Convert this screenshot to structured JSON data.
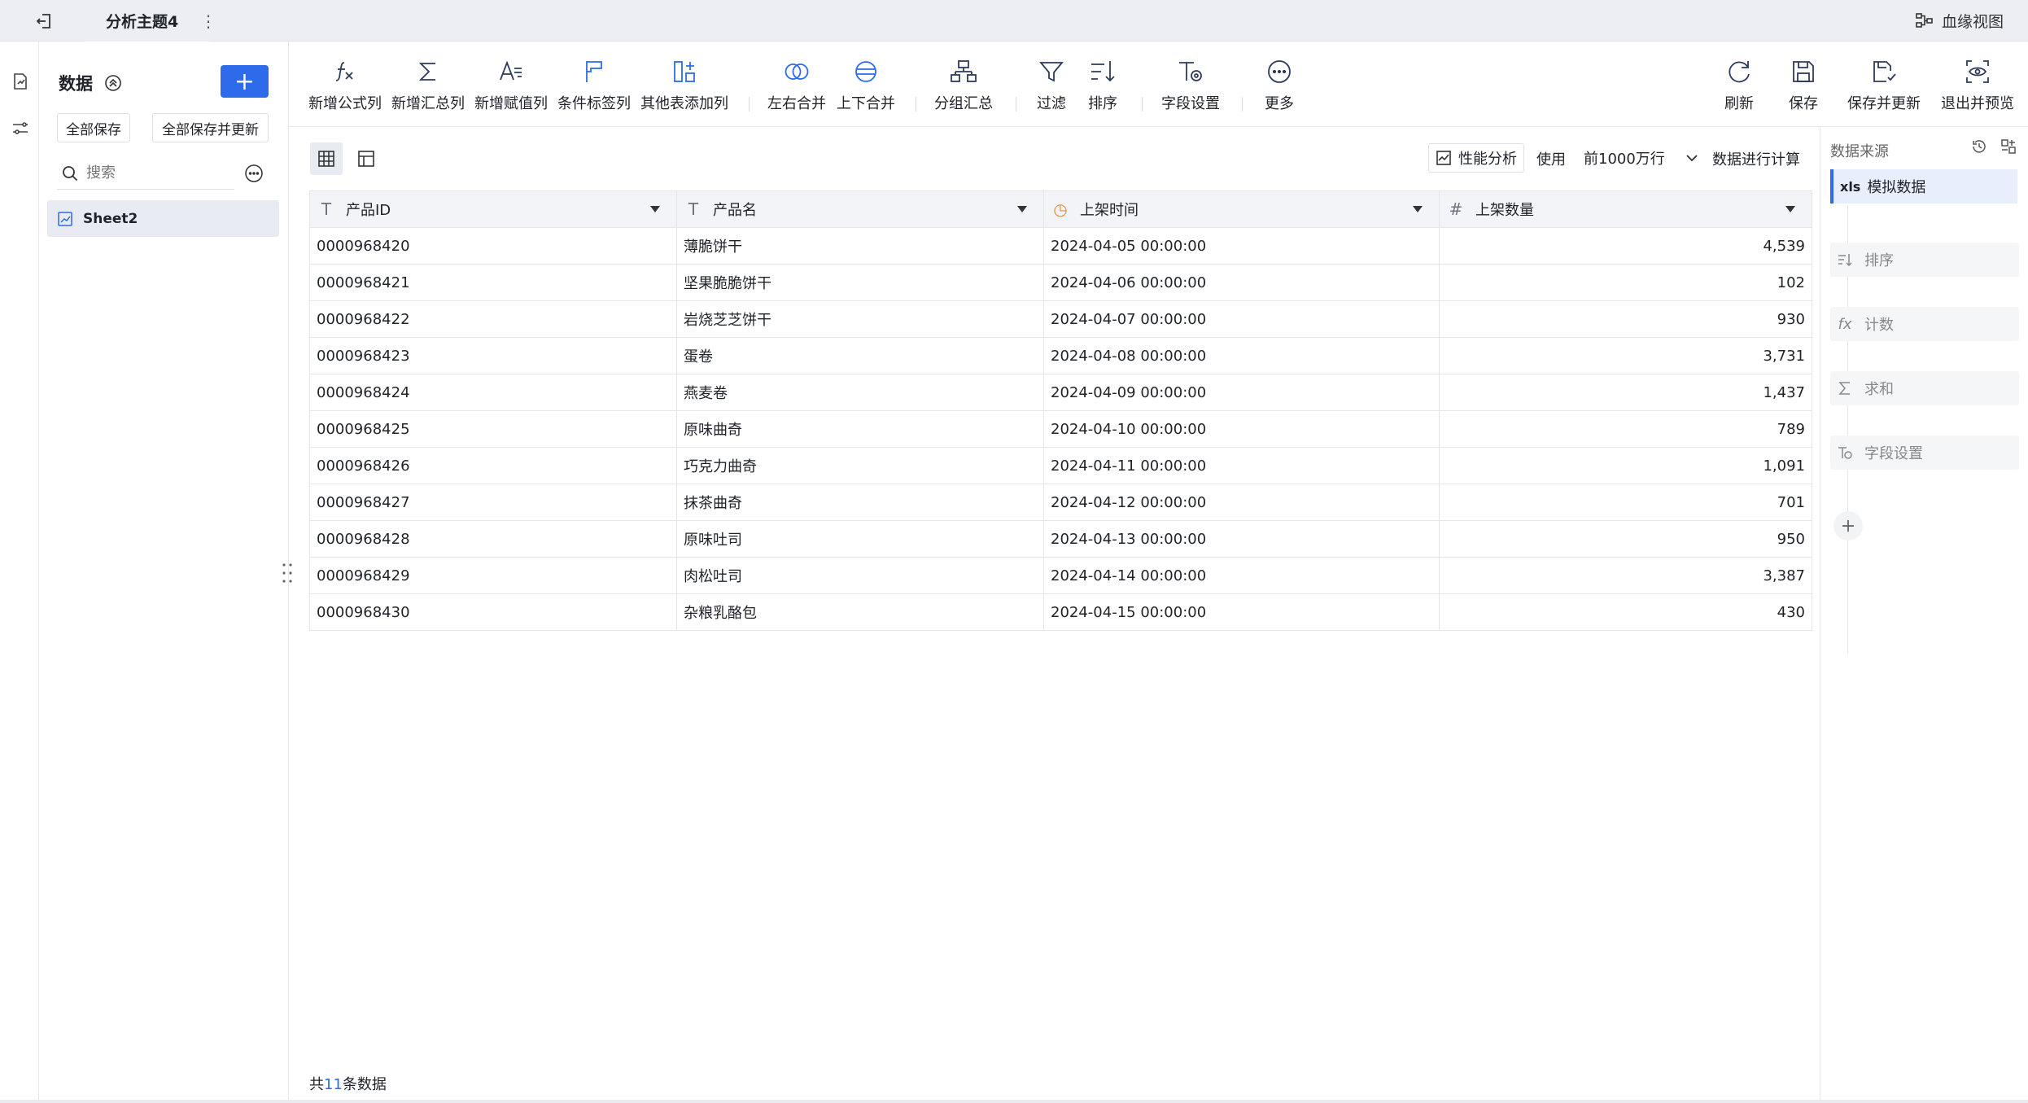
{
  "topbar": {
    "tab_title": "分析主题4",
    "tab_menu": "⋮",
    "lineage_label": "血缘视图"
  },
  "panel": {
    "title": "数据",
    "add_label": "+",
    "save_all": "全部保存",
    "save_all_update": "全部保存并更新",
    "search_placeholder": "搜索",
    "sheet_name": "Sheet2"
  },
  "toolbar": {
    "formula": "新增公式列",
    "summary": "新增汇总列",
    "assign": "新增赋值列",
    "condition": "条件标签列",
    "other_table": "其他表添加列",
    "lr_merge": "左右合并",
    "ud_merge": "上下合并",
    "group": "分组汇总",
    "filter": "过滤",
    "sort": "排序",
    "field_settings": "字段设置",
    "more": "更多",
    "refresh": "刷新",
    "save": "保存",
    "save_update": "保存并更新",
    "exit_preview": "退出并预览"
  },
  "main": {
    "perf_label": "性能分析",
    "use_label": "使用",
    "rows_value": "前1000万行",
    "calc_label": "数据进行计算"
  },
  "table": {
    "columns": [
      {
        "name": "产品ID",
        "type_icon": "T"
      },
      {
        "name": "产品名",
        "type_icon": "T"
      },
      {
        "name": "上架时间",
        "type_icon": "◷"
      },
      {
        "name": "上架数量",
        "type_icon": "#"
      }
    ],
    "rows": [
      [
        "0000968420",
        "薄脆饼干",
        "2024-04-05 00:00:00",
        "4,539"
      ],
      [
        "0000968421",
        "坚果脆脆饼干",
        "2024-04-06 00:00:00",
        "102"
      ],
      [
        "0000968422",
        "岩烧芝芝饼干",
        "2024-04-07 00:00:00",
        "930"
      ],
      [
        "0000968423",
        "蛋卷",
        "2024-04-08 00:00:00",
        "3,731"
      ],
      [
        "0000968424",
        "燕麦卷",
        "2024-04-09 00:00:00",
        "1,437"
      ],
      [
        "0000968425",
        "原味曲奇",
        "2024-04-10 00:00:00",
        "789"
      ],
      [
        "0000968426",
        "巧克力曲奇",
        "2024-04-11 00:00:00",
        "1,091"
      ],
      [
        "0000968427",
        "抹茶曲奇",
        "2024-04-12 00:00:00",
        "701"
      ],
      [
        "0000968428",
        "原味吐司",
        "2024-04-13 00:00:00",
        "950"
      ],
      [
        "0000968429",
        "肉松吐司",
        "2024-04-14 00:00:00",
        "3,387"
      ],
      [
        "0000968430",
        "杂粮乳酪包",
        "2024-04-15 00:00:00",
        "430"
      ]
    ]
  },
  "footer": {
    "prefix": "共",
    "count": "11",
    "suffix": "条数据"
  },
  "steps": {
    "title": "数据来源",
    "source_badge": "xls",
    "source_name": "模拟数据",
    "items": [
      {
        "label": "排序",
        "icon": "sort-icon"
      },
      {
        "label": "计数",
        "icon": "formula-icon"
      },
      {
        "label": "求和",
        "icon": "sigma-icon"
      },
      {
        "label": "字段设置",
        "icon": "field-settings-icon"
      }
    ],
    "add_label": "+"
  },
  "colors": {
    "accent": "#2d6bea",
    "toolbar_icon": "#2d3a5c",
    "header_bg": "#f2f4f7",
    "time_icon": "#e8893a"
  }
}
